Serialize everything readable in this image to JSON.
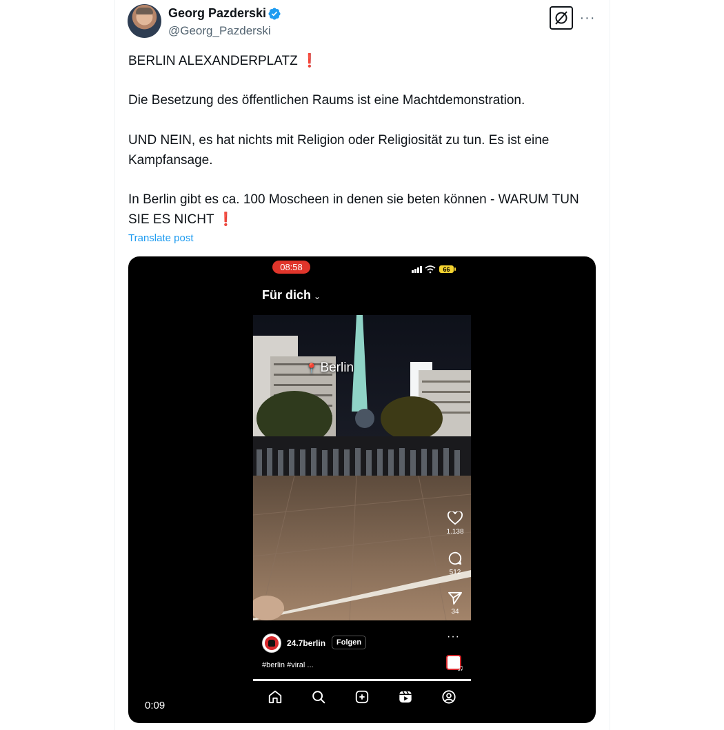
{
  "author": {
    "name": "Georg Pazderski",
    "handle": "@Georg_Pazderski",
    "verified_icon": "verified-badge-icon",
    "verified_color": "#1d9bf0"
  },
  "header_actions": {
    "grok_icon": "grok-icon",
    "more_icon": "more-horizontal-icon",
    "more_label": "···"
  },
  "tweet": {
    "line1": "BERLIN ALEXANDERPLATZ",
    "line1_mark": "❗",
    "line2": "Die Besetzung des öffentlichen Raums ist eine Machtdemonstration.",
    "line3": "UND NEIN, es hat nichts mit Religion oder Religiosität zu tun. Es ist eine Kampfansage.",
    "line4": "In Berlin gibt es ca. 100 Moscheen in denen sie beten können - WARUM TUN SIE ES NICHT",
    "line4_mark": "❗",
    "translate": "Translate post"
  },
  "media": {
    "video_time": "0:09",
    "phone": {
      "status_time": "08:58",
      "battery": "66",
      "feed_title": "Für dich",
      "feed_chevron": "⌄",
      "location_label": "Berlin",
      "location_pin": "📍",
      "likes": "1.138",
      "comments": "512",
      "shares": "34",
      "username": "24.7berlin",
      "follow_label": "Folgen",
      "hashtags": "#berlin #viral ...",
      "more_dots": "···",
      "music_note": "♫",
      "progress": 1.0
    },
    "nav_icons": [
      "home-icon",
      "search-icon",
      "create-icon",
      "reels-icon",
      "profile-icon"
    ]
  },
  "colors": {
    "accent": "#1d9bf0",
    "text": "#0f1419",
    "muted": "#536471",
    "alert": "#d9232e"
  }
}
